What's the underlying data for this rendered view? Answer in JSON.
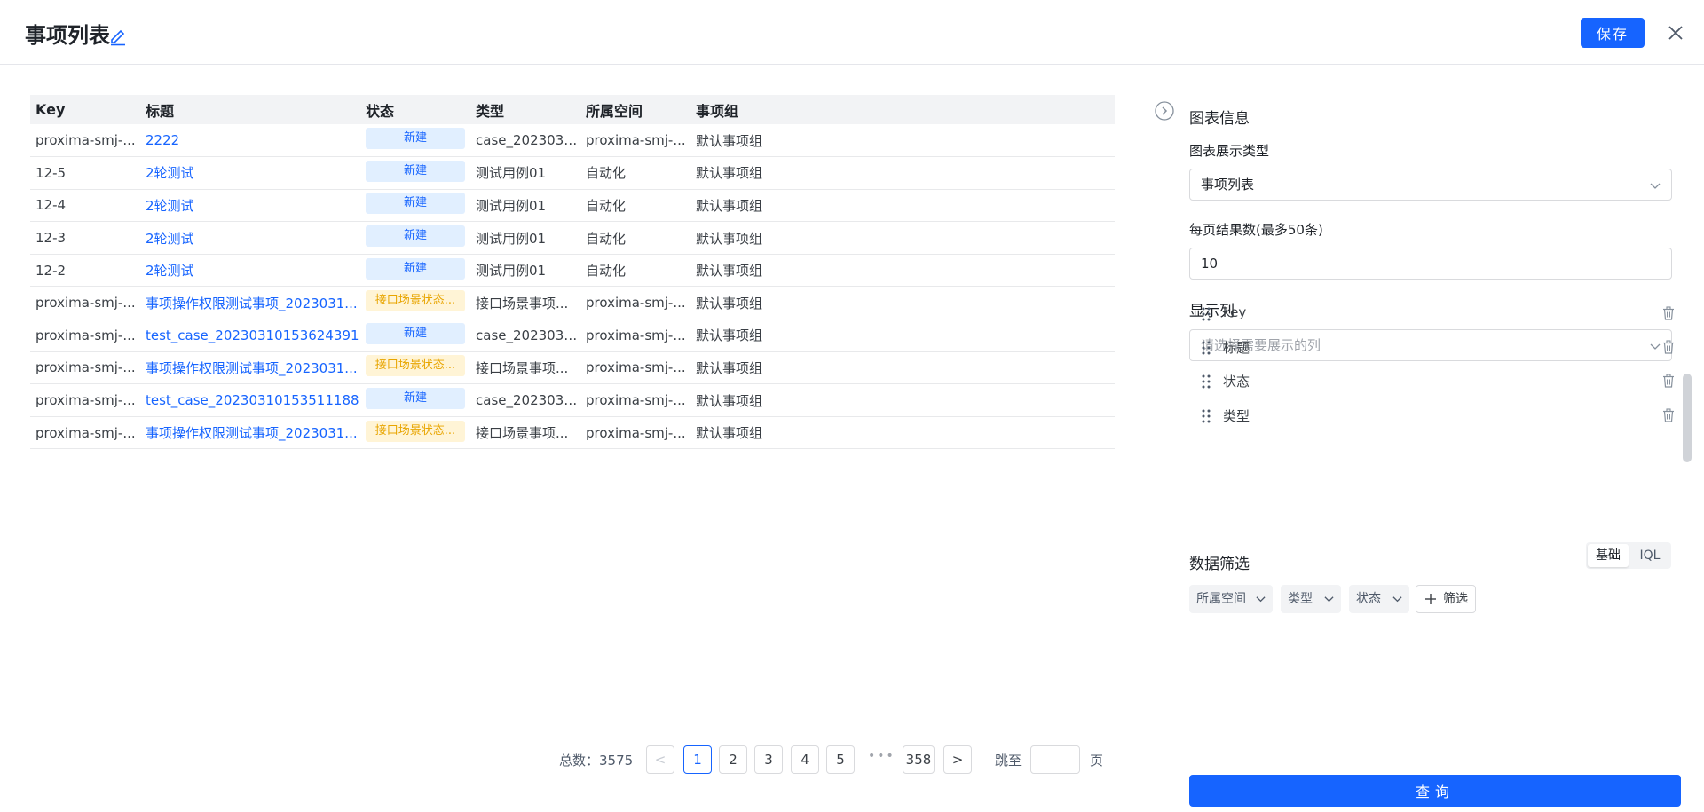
{
  "header": {
    "title": "事项列表",
    "save_label": "保存"
  },
  "table": {
    "columns": [
      "Key",
      "标题",
      "状态",
      "类型",
      "所属空间",
      "事项组"
    ],
    "rows": [
      {
        "key": "proxima-smj-...",
        "title": "2222",
        "status": "新建",
        "status_kind": "new",
        "type": "case_2023031...",
        "space": "proxima-smj-...",
        "group": "默认事项组"
      },
      {
        "key": "12-5",
        "title": "2轮测试",
        "status": "新建",
        "status_kind": "new",
        "type": "测试用例01",
        "space": "自动化",
        "group": "默认事项组"
      },
      {
        "key": "12-4",
        "title": "2轮测试",
        "status": "新建",
        "status_kind": "new",
        "type": "测试用例01",
        "space": "自动化",
        "group": "默认事项组"
      },
      {
        "key": "12-3",
        "title": "2轮测试",
        "status": "新建",
        "status_kind": "new",
        "type": "测试用例01",
        "space": "自动化",
        "group": "默认事项组"
      },
      {
        "key": "12-2",
        "title": "2轮测试",
        "status": "新建",
        "status_kind": "new",
        "type": "测试用例01",
        "space": "自动化",
        "group": "默认事项组"
      },
      {
        "key": "proxima-smj-...",
        "title": "事项操作权限测试事项_2023031...",
        "status": "接口场景状态...",
        "status_kind": "warn",
        "type": "接口场景事项...",
        "space": "proxima-smj-...",
        "group": "默认事项组"
      },
      {
        "key": "proxima-smj-...",
        "title": "test_case_20230310153624391",
        "status": "新建",
        "status_kind": "new",
        "type": "case_2023031...",
        "space": "proxima-smj-...",
        "group": "默认事项组"
      },
      {
        "key": "proxima-smj-...",
        "title": "事项操作权限测试事项_2023031...",
        "status": "接口场景状态...",
        "status_kind": "warn",
        "type": "接口场景事项...",
        "space": "proxima-smj-...",
        "group": "默认事项组"
      },
      {
        "key": "proxima-smj-...",
        "title": "test_case_20230310153511188",
        "status": "新建",
        "status_kind": "new",
        "type": "case_2023031...",
        "space": "proxima-smj-...",
        "group": "默认事项组"
      },
      {
        "key": "proxima-smj-...",
        "title": "事项操作权限测试事项_2023031...",
        "status": "接口场景状态...",
        "status_kind": "warn",
        "type": "接口场景事项...",
        "space": "proxima-smj-...",
        "group": "默认事项组"
      }
    ]
  },
  "pagination": {
    "total_label": "总数：",
    "total": "3575",
    "prev": "<",
    "next": ">",
    "pages": [
      "1",
      "2",
      "3",
      "4",
      "5"
    ],
    "ellipsis": "•••",
    "last_page": "358",
    "current": "1",
    "jump_label": "跳至",
    "page_unit": "页"
  },
  "panel": {
    "section_chart": "图表信息",
    "chart_type_label": "图表展示类型",
    "chart_type_value": "事项列表",
    "page_size_label": "每页结果数(最多50条)",
    "page_size_value": "10",
    "columns_label": "显示列",
    "columns_placeholder": "请选择需要展示的列",
    "columns": [
      "key",
      "标题",
      "状态",
      "类型"
    ],
    "filter_label": "数据筛选",
    "filter_modes": [
      "基础",
      "IQL"
    ],
    "filter_mode_active": "基础",
    "filters": [
      "所属空间",
      "类型",
      "状态"
    ],
    "add_filter_label": "筛选",
    "query_label": "查询"
  },
  "colors": {
    "primary": "#1664ff",
    "status_new_bg": "#e1efff",
    "status_warn_bg": "#fff4d6",
    "status_warn_text": "#e8a500"
  }
}
